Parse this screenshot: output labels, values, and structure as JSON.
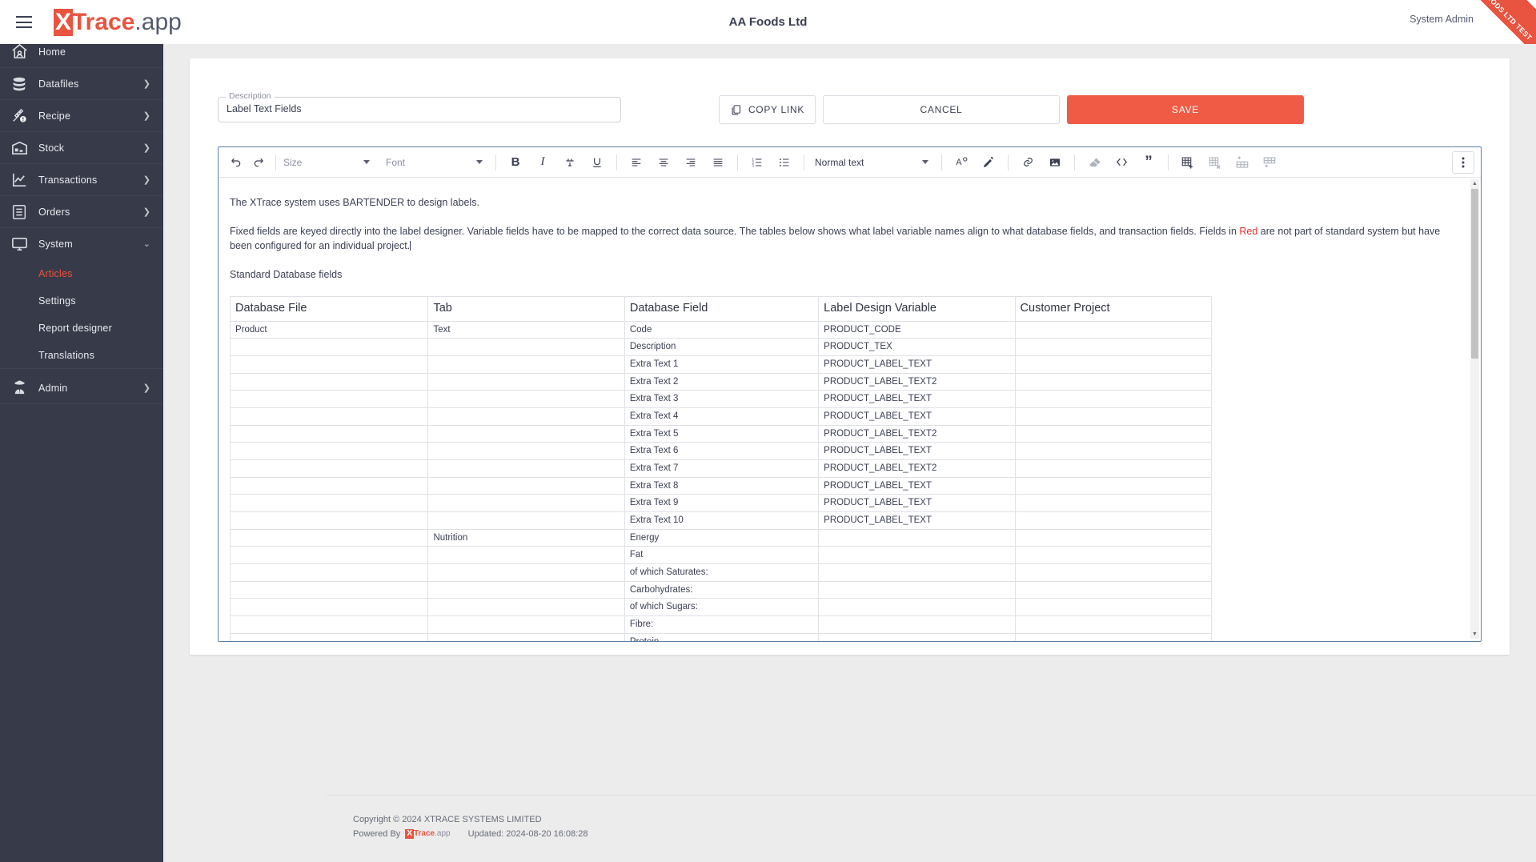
{
  "topbar": {
    "menu_icon": "hamburger-icon",
    "brand": {
      "x": "X",
      "trace": "Trace",
      "app": ".app"
    },
    "company_title": "AA Foods Ltd",
    "user": "System Admin",
    "ribbon": "AA FOODS LTD TEST"
  },
  "sidebar": {
    "items": [
      {
        "label": "Home",
        "icon": "home-icon",
        "expandable": false,
        "active": false
      },
      {
        "label": "Datafiles",
        "icon": "database-icon",
        "expandable": true,
        "active": false
      },
      {
        "label": "Recipe",
        "icon": "wheat-alert-icon",
        "expandable": true,
        "active": false
      },
      {
        "label": "Stock",
        "icon": "warehouse-icon",
        "expandable": true,
        "active": false
      },
      {
        "label": "Transactions",
        "icon": "line-chart-icon",
        "expandable": true,
        "active": false
      },
      {
        "label": "Orders",
        "icon": "checklist-icon",
        "expandable": true,
        "active": false
      },
      {
        "label": "System",
        "icon": "monitor-icon",
        "expandable": true,
        "expanded": true,
        "active": false
      }
    ],
    "system_children": [
      {
        "label": "Articles",
        "active": true
      },
      {
        "label": "Settings",
        "active": false
      },
      {
        "label": "Report designer",
        "active": false
      },
      {
        "label": "Translations",
        "active": false
      }
    ],
    "admin": {
      "label": "Admin",
      "icon": "spy-icon",
      "expandable": true
    }
  },
  "form": {
    "description_legend": "Description",
    "description_value": "Label Text Fields",
    "description_placeholder": "Description",
    "copy_link_label": "COPY LINK",
    "copy_link_icon": "copy-icon",
    "cancel_label": "CANCEL",
    "save_label": "SAVE"
  },
  "toolbar": {
    "undo": "undo-icon",
    "redo": "redo-icon",
    "size_label": "Size",
    "font_label": "Font",
    "bold": "B",
    "italic": "I",
    "strikethrough": "strikethrough-icon",
    "underline": "U",
    "align_left": "align-left-icon",
    "align_center": "align-center-icon",
    "align_right": "align-right-icon",
    "align_justify": "align-justify-icon",
    "ordered_list": "ordered-list-icon",
    "bullet_list": "bullet-list-icon",
    "block_format": "Normal text",
    "text_color": "text-color-icon",
    "highlight": "highlight-icon",
    "link": "link-icon",
    "image": "image-icon",
    "clear_format": "eraser-icon",
    "code": "code-icon",
    "quote": "quote-icon",
    "insert_table": "insert-table-icon",
    "delete_table": "delete-table-icon",
    "insert_row": "insert-row-icon",
    "insert_column": "insert-column-icon",
    "more": "more-vertical-icon"
  },
  "document": {
    "para1": "The XTrace system uses BARTENDER to design labels.",
    "para2_a": "Fixed fields are keyed directly into the label designer. Variable fields have to be mapped to the correct data source. The tables below shows what label variable names align to what database fields, and transaction fields. Fields in ",
    "para2_red": "Red",
    "para2_b": " are not part of standard system but have been configured for an individual project.",
    "section_title": "Standard Database fields",
    "table": {
      "headers": [
        "Database File",
        "Tab",
        "Database Field",
        "Label Design Variable",
        "Customer Project"
      ],
      "rows": [
        [
          "Product",
          "Text",
          "Code",
          "PRODUCT_CODE",
          ""
        ],
        [
          "",
          "",
          "Description",
          "PRODUCT_TEX",
          ""
        ],
        [
          "",
          "",
          "Extra Text 1",
          "PRODUCT_LABEL_TEXT",
          ""
        ],
        [
          "",
          "",
          "Extra Text 2",
          "PRODUCT_LABEL_TEXT2",
          ""
        ],
        [
          "",
          "",
          "Extra Text 3",
          "PRODUCT_LABEL_TEXT",
          ""
        ],
        [
          "",
          "",
          "Extra Text 4",
          "PRODUCT_LABEL_TEXT",
          ""
        ],
        [
          "",
          "",
          "Extra Text 5",
          "PRODUCT_LABEL_TEXT2",
          ""
        ],
        [
          "",
          "",
          "Extra Text 6",
          "PRODUCT_LABEL_TEXT",
          ""
        ],
        [
          "",
          "",
          "Extra Text 7",
          "PRODUCT_LABEL_TEXT2",
          ""
        ],
        [
          "",
          "",
          "Extra Text 8",
          "PRODUCT_LABEL_TEXT",
          ""
        ],
        [
          "",
          "",
          "Extra Text 9",
          "PRODUCT_LABEL_TEXT",
          ""
        ],
        [
          "",
          "",
          "Extra Text 10",
          "PRODUCT_LABEL_TEXT",
          ""
        ],
        [
          "",
          "Nutrition",
          "Energy",
          "",
          ""
        ],
        [
          "",
          "",
          "Fat",
          "",
          ""
        ],
        [
          "",
          "",
          "of which Saturates:",
          "",
          ""
        ],
        [
          "",
          "",
          "Carbohydrates:",
          "",
          ""
        ],
        [
          "",
          "",
          "of which Sugars:",
          "",
          ""
        ],
        [
          "",
          "",
          "Fibre:",
          "",
          ""
        ],
        [
          "",
          "",
          "Protein",
          "",
          ""
        ]
      ]
    }
  },
  "footer": {
    "copyright": "Copyright © 2024 XTRACE SYSTEMS LIMITED",
    "powered_by": "Powered By",
    "brand_x": "X",
    "brand_trace": "Trace",
    "brand_app": ".app",
    "updated": "Updated: 2024-08-20 16:08:28"
  }
}
